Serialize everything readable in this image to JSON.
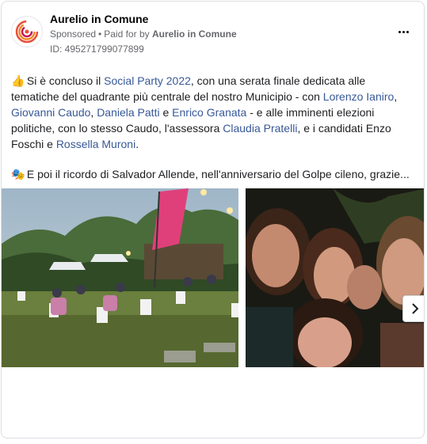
{
  "post": {
    "page_name": "Aurelio in Comune",
    "sponsored_label": "Sponsored",
    "paid_prefix": "Paid for by",
    "paid_by": "Aurelio in Comune",
    "ad_id": "ID: 495271799077899"
  },
  "text": {
    "emoji1": "👍",
    "t1": "Si è concluso il ",
    "l_social_party": "Social Party 2022",
    "t2": ", con una serata finale dedicata alle tematiche del quadrante più centrale del nostro Municipio - con ",
    "l_lorenzo": "Lorenzo Ianiro",
    "sep1": ", ",
    "l_giovanni": "Giovanni Caudo",
    "sep2": ", ",
    "l_daniela": "Daniela Patti",
    "t3": " e ",
    "l_enrico": "Enrico Granata",
    "t4": " - e alle imminenti elezioni politiche, con lo stesso Caudo, l'assessora ",
    "l_claudia": "Claudia Pratelli",
    "t5": ", e i candidati Enzo Foschi e ",
    "l_rossella": "Rossella Muroni",
    "t6": ".",
    "emoji2": "🎭",
    "p2": "E poi il ricordo di Salvador Allende, nell'anniversario del Golpe cileno, grazie..."
  },
  "colors": {
    "link": "#385898",
    "secondary": "#65676b"
  },
  "icons": {
    "more": "more-horizontal-icon",
    "next": "chevron-right-icon"
  }
}
